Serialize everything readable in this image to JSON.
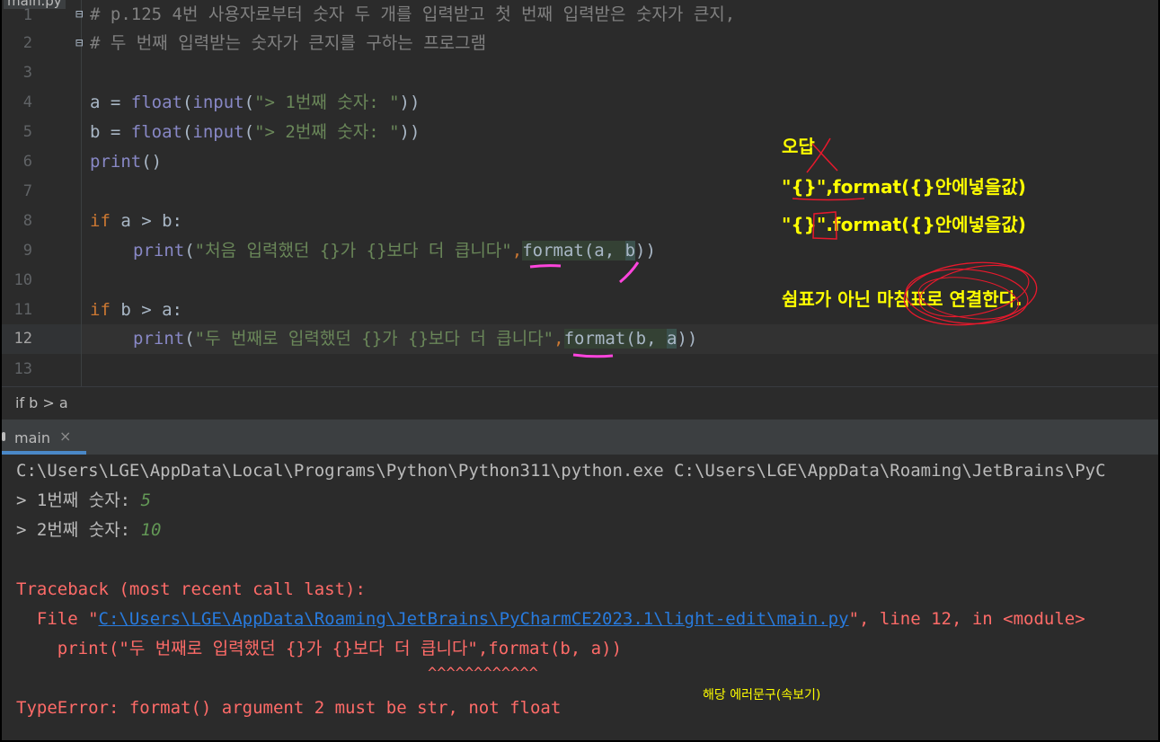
{
  "editor": {
    "file_tab": "main.py",
    "lines": [
      {
        "n": "1",
        "text": "# p.125 4번 사용자로부터 숫자 두 개를 입력받고 첫 번째 입력받은 숫자가 큰지,"
      },
      {
        "n": "2",
        "text": "# 두 번째 입력받는 숫자가 큰지를 구하는 프로그램"
      },
      {
        "n": "3",
        "text": ""
      },
      {
        "n": "4",
        "a": "a = ",
        "b": "float",
        "c": "(",
        "d": "input",
        "e": "(",
        "f": "\"> 1번째 숫자: \"",
        "g": "))"
      },
      {
        "n": "5",
        "a": "b = ",
        "b": "float",
        "c": "(",
        "d": "input",
        "e": "(",
        "f": "\"> 2번째 숫자: \"",
        "g": "))"
      },
      {
        "n": "6",
        "a": "print",
        "b": "()"
      },
      {
        "n": "7",
        "text": ""
      },
      {
        "n": "8",
        "a": "if",
        "b": " a > b:"
      },
      {
        "n": "9",
        "a": "print",
        "b": "(",
        "c": "\"처음 입력했던 {}가 {}보다 더 큽니다\"",
        "d": ",",
        "e": "format",
        "f": "(a, ",
        "g": "b",
        "h": "))"
      },
      {
        "n": "10",
        "text": ""
      },
      {
        "n": "11",
        "a": "if",
        "b": " b > a:"
      },
      {
        "n": "12",
        "a": "print",
        "b": "(",
        "c": "\"두 번째로 입력했던 {}가 {}보다 더 큽니다\"",
        "d": ",",
        "e": "format",
        "f": "(b, ",
        "g": "a",
        "h": "))"
      },
      {
        "n": "13",
        "text": ""
      }
    ],
    "current_line": "12"
  },
  "annotations": {
    "wrong_answer": "오답",
    "wrong_form": "\"{}\",format({}안에넣을값)",
    "right_form": "\"{}\".format({}안에넣을값)",
    "explanation": "쉼표가 아닌 마침표로 연결한다.",
    "note": "해당 에러문구(속보기)",
    "color": "#ffff00",
    "mark_color": "#e8192c",
    "underline_color": "#ff44dd"
  },
  "breadcrumb": "if b > a",
  "run_panel": {
    "tab_label": "main",
    "close_icon": "×",
    "console": {
      "command": "C:\\Users\\LGE\\AppData\\Local\\Programs\\Python\\Python311\\python.exe C:\\Users\\LGE\\AppData\\Roaming\\JetBrains\\PyC",
      "prompt1": "> 1번째 숫자: ",
      "input1": "5",
      "prompt2": "> 2번째 숫자: ",
      "input2": "10",
      "traceback": "Traceback (most recent call last):",
      "file_prefix": "  File \"",
      "file_path": "C:\\Users\\LGE\\AppData\\Roaming\\JetBrains\\PyCharmCE2023.1\\light-edit\\main.py",
      "file_suffix": "\", line 12, in <module>",
      "code_line": "    print(\"두 번째로 입력했던 {}가 {}보다 더 큽니다\",format(b, a))",
      "carets": "^^^^^^^^^^^^",
      "error": "TypeError: format() argument 2 must be str, not float"
    }
  }
}
